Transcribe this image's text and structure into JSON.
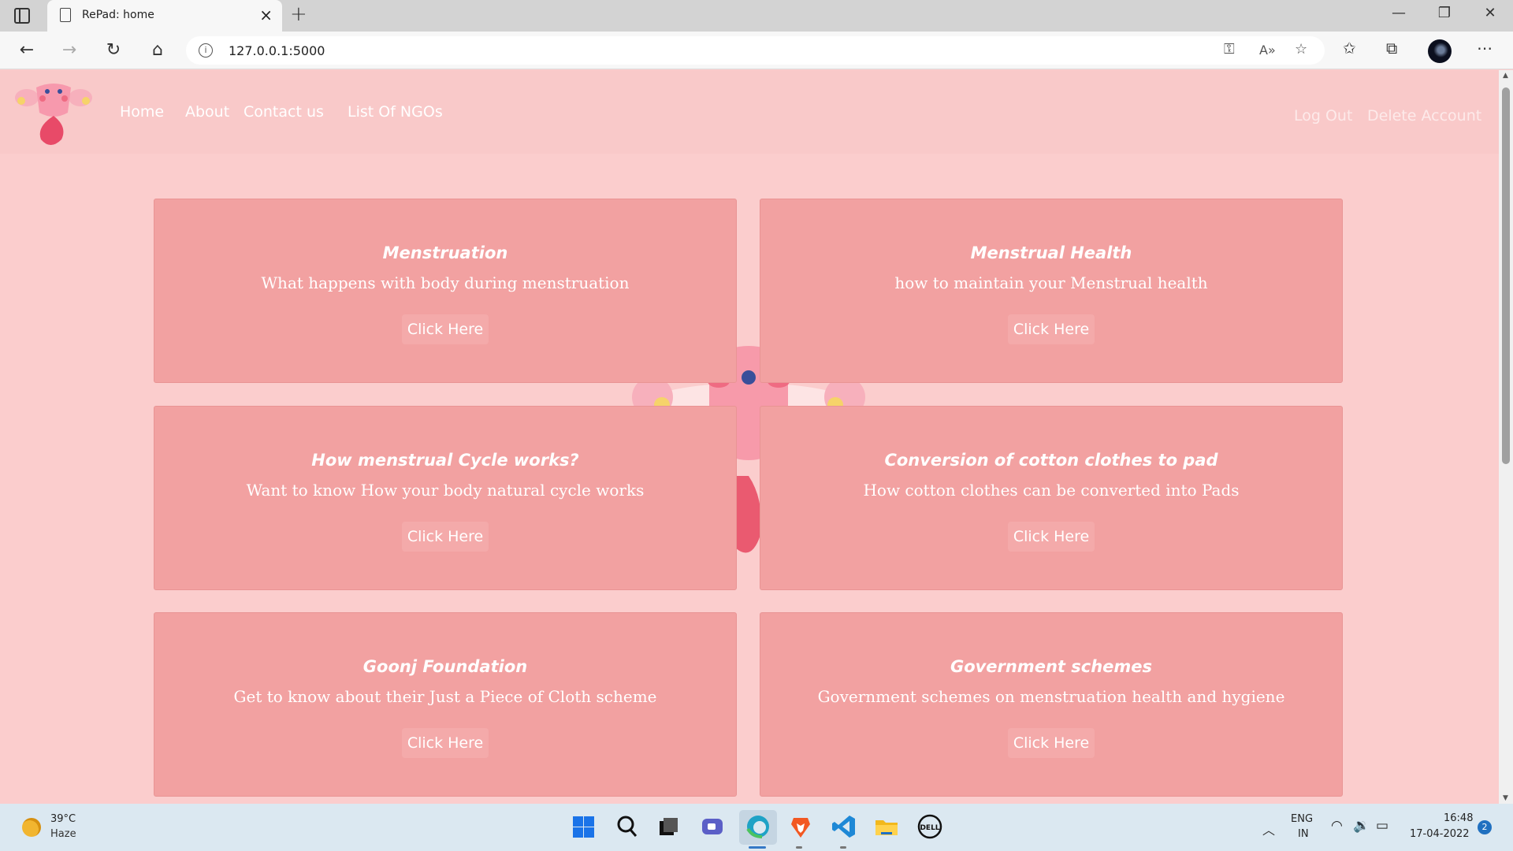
{
  "browser": {
    "tab_title": "RePad: home",
    "url": "127.0.0.1:5000"
  },
  "nav": {
    "home": "Home",
    "about": "About",
    "contact": "Contact us",
    "ngos": "List Of NGOs",
    "logout": "Log Out",
    "delete": "Delete Account"
  },
  "cards": [
    {
      "title": "Menstruation",
      "desc": "What happens with body during menstruation",
      "button": "Click Here"
    },
    {
      "title": "Menstrual Health",
      "desc": "how to maintain your Menstrual health",
      "button": "Click Here"
    },
    {
      "title": "How menstrual Cycle works?",
      "desc": "Want to know How your body natural cycle works",
      "button": "Click Here"
    },
    {
      "title": "Conversion of cotton clothes to pad",
      "desc": "How cotton clothes can be converted into Pads",
      "button": "Click Here"
    },
    {
      "title": "Goonj Foundation",
      "desc": "Get to know about their Just a Piece of Cloth scheme",
      "button": "Click Here"
    },
    {
      "title": "Government schemes",
      "desc": "Government schemes on menstruation health and hygiene",
      "button": "Click Here"
    }
  ],
  "taskbar": {
    "temp": "39°C",
    "weather": "Haze",
    "lang_line1": "ENG",
    "lang_line2": "IN",
    "time": "16:48",
    "date": "17-04-2022",
    "notifications": "2"
  },
  "colors": {
    "page_bg": "#fbcdcd",
    "card_bg": "#f2a1a1",
    "accent": "#f08080"
  }
}
